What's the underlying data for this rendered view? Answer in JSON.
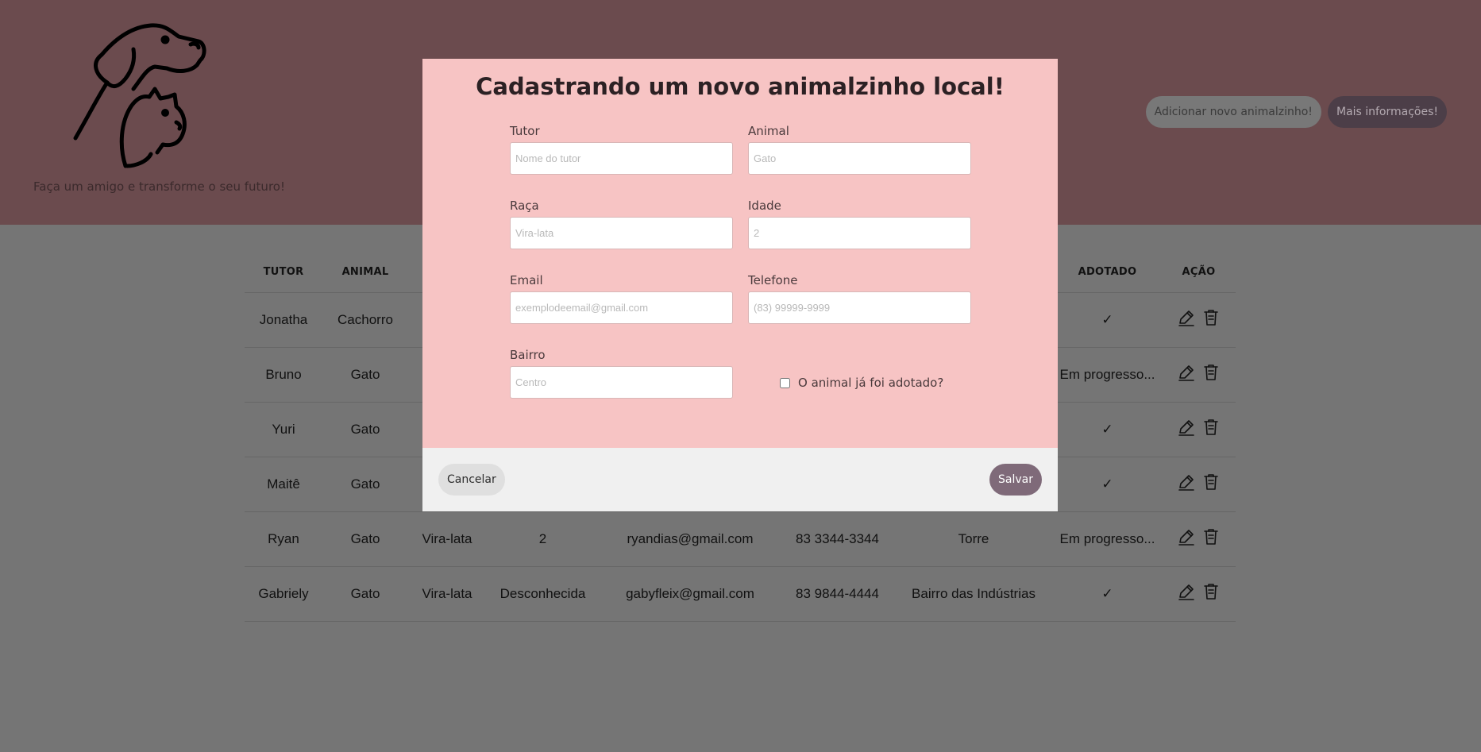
{
  "header": {
    "slogan": "Faça um amigo e transforme o seu futuro!",
    "add_button": "Adicionar novo animalzinho!",
    "info_button": "Mais informações!"
  },
  "table": {
    "headers": {
      "tutor": "TUTOR",
      "animal": "ANIMAL",
      "adotado": "ADOTADO",
      "acao": "AÇÃO"
    },
    "rows": [
      {
        "tutor": "Jonatha",
        "animal": "Cachorro",
        "raca": "",
        "idade": "",
        "email": "",
        "telefone": "",
        "bairro": "",
        "adotado": "✓"
      },
      {
        "tutor": "Bruno",
        "animal": "Gato",
        "raca": "",
        "idade": "",
        "email": "",
        "telefone": "",
        "bairro": "",
        "adotado": "Em progresso..."
      },
      {
        "tutor": "Yuri",
        "animal": "Gato",
        "raca": "",
        "idade": "",
        "email": "",
        "telefone": "",
        "bairro": "",
        "adotado": "✓"
      },
      {
        "tutor": "Maitê",
        "animal": "Gato",
        "raca": "",
        "idade": "",
        "email": "",
        "telefone": "",
        "bairro": "",
        "adotado": "✓"
      },
      {
        "tutor": "Ryan",
        "animal": "Gato",
        "raca": "Vira-lata",
        "idade": "2",
        "email": "ryandias@gmail.com",
        "telefone": "83 3344-3344",
        "bairro": "Torre",
        "adotado": "Em progresso..."
      },
      {
        "tutor": "Gabriely",
        "animal": "Gato",
        "raca": "Vira-lata",
        "idade": "Desconhecida",
        "email": "gabyfleix@gmail.com",
        "telefone": "83 9844-4444",
        "bairro": "Bairro das Indústrias",
        "adotado": "✓"
      }
    ]
  },
  "modal": {
    "title": "Cadastrando um novo animalzinho local!",
    "fields": {
      "tutor": {
        "label": "Tutor",
        "placeholder": "Nome do tutor"
      },
      "animal": {
        "label": "Animal",
        "placeholder": "Gato"
      },
      "raca": {
        "label": "Raça",
        "placeholder": "Vira-lata"
      },
      "idade": {
        "label": "Idade",
        "placeholder": "2"
      },
      "email": {
        "label": "Email",
        "placeholder": "exemplodeemail@gmail.com"
      },
      "telefone": {
        "label": "Telefone",
        "placeholder": "(83) 99999-9999"
      },
      "bairro": {
        "label": "Bairro",
        "placeholder": "Centro"
      }
    },
    "adopted_checkbox_label": "O animal já foi adotado?",
    "cancel_button": "Cancelar",
    "save_button": "Salvar"
  },
  "icons": {
    "logo": "dog-and-cat-logo",
    "edit": "pencil-icon",
    "delete": "trash-icon"
  },
  "colors": {
    "header_bg": "#6b4b4e",
    "modal_bg": "#f7c4c4",
    "save_button": "#7f6a79",
    "info_button": "#4c3e48"
  }
}
